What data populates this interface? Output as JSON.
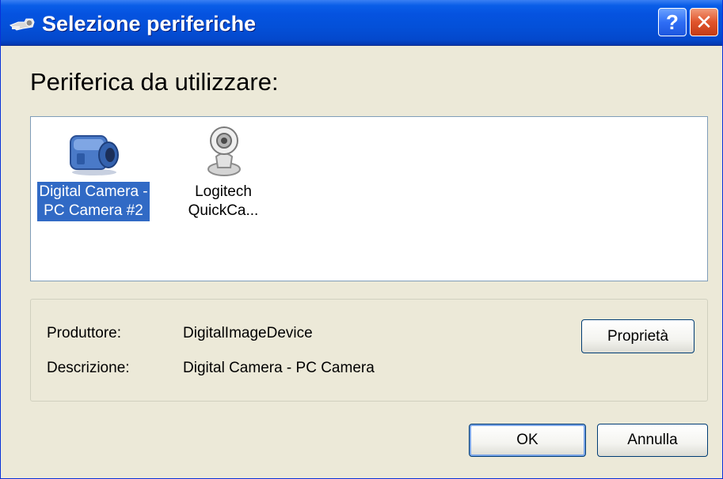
{
  "window": {
    "title": "Selezione periferiche",
    "title_icon": "camera-tray-icon",
    "help_label": "?",
    "close_label": "✕"
  },
  "heading": "Periferica da utilizzare:",
  "devices": [
    {
      "label": "Digital Camera - PC Camera #2",
      "icon": "video-camera-icon",
      "selected": true
    },
    {
      "label": "Logitech QuickCa...",
      "icon": "webcam-icon",
      "selected": false
    }
  ],
  "details": {
    "manufacturer_label": "Produttore:",
    "manufacturer_value": "DigitalImageDevice",
    "description_label": "Descrizione:",
    "description_value": "Digital Camera - PC Camera",
    "properties_button": "Proprietà"
  },
  "buttons": {
    "ok": "OK",
    "cancel": "Annulla"
  },
  "colors": {
    "titlebar": "#0450d8",
    "selection": "#316ac5",
    "face": "#ece9d8"
  }
}
